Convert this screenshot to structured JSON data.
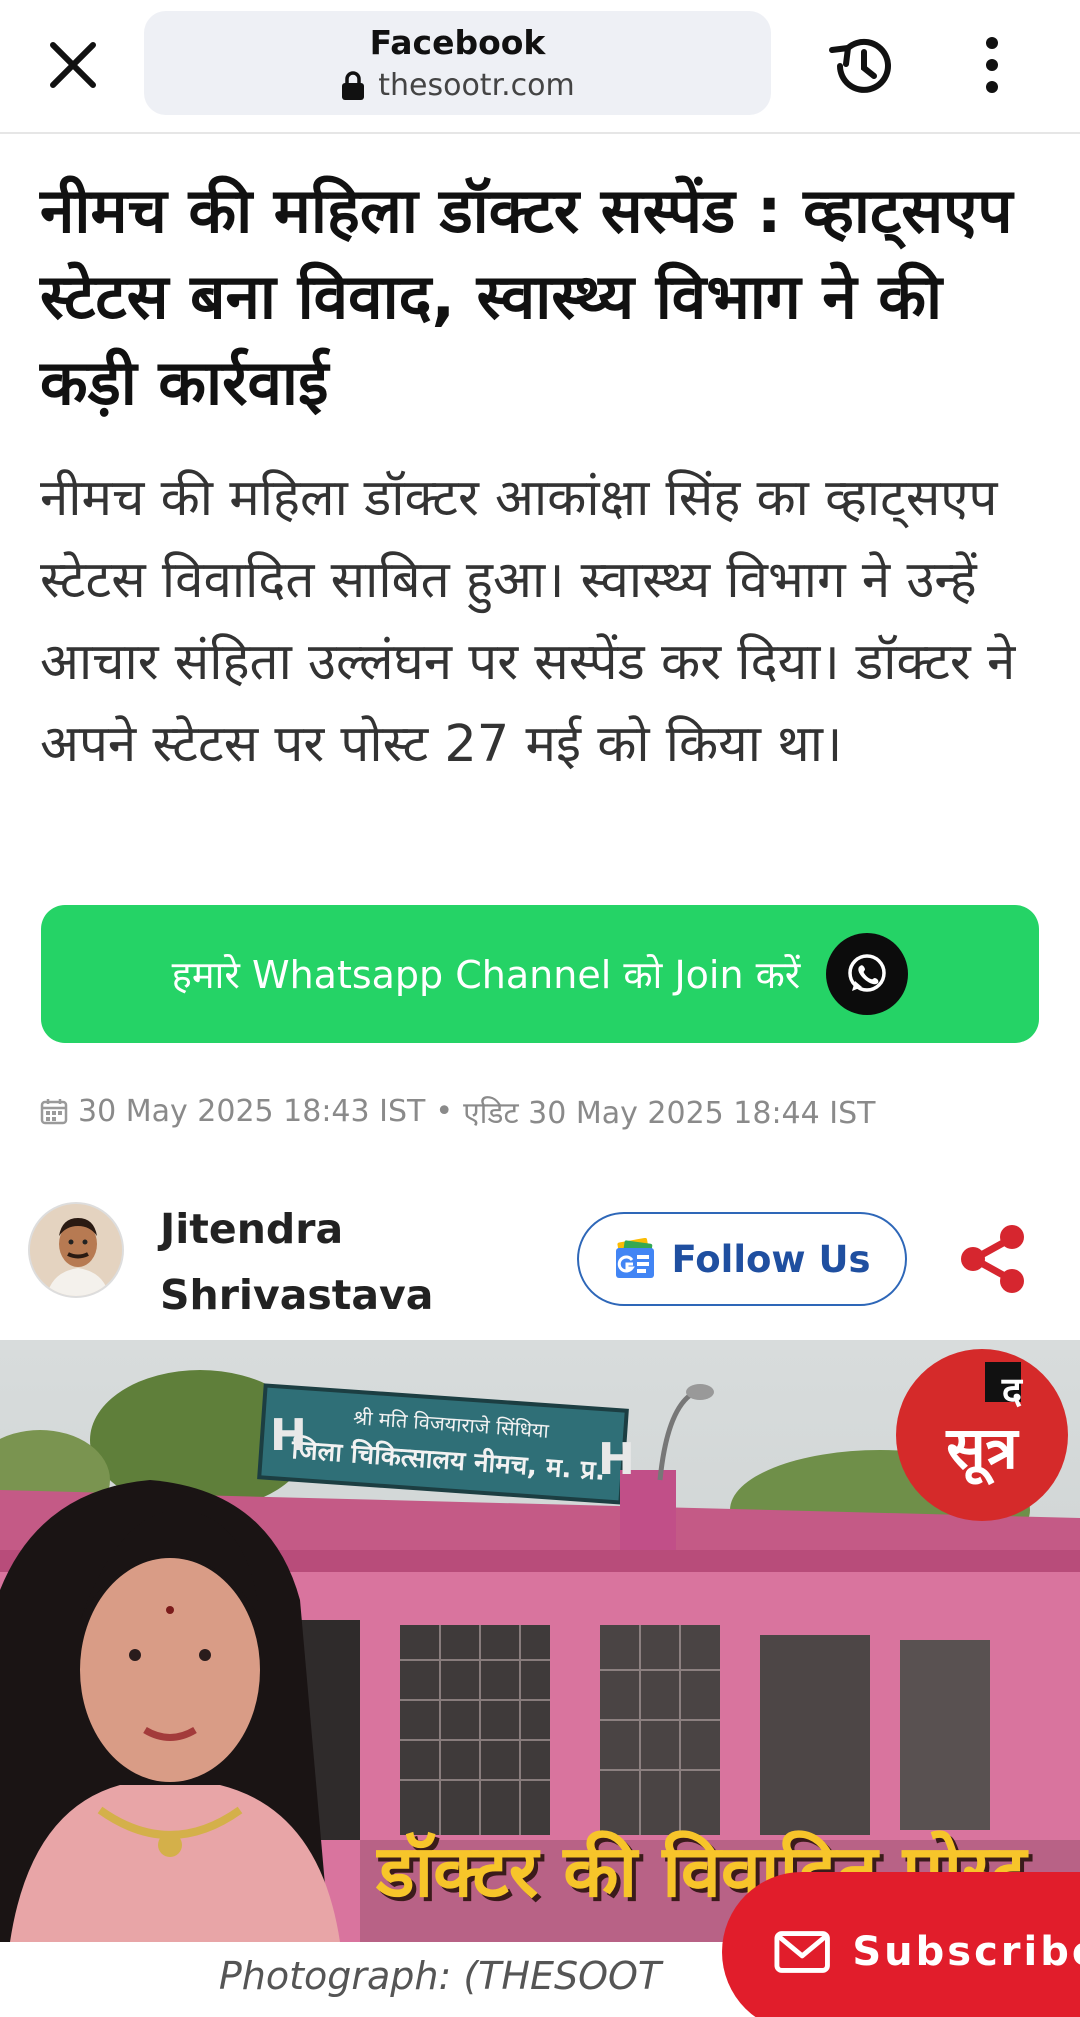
{
  "browser": {
    "page_title": "Facebook",
    "host": "thesootr.com"
  },
  "article": {
    "headline": "नीमच की महिला डॉक्टर सस्पेंड : व्हाट्सएप स्टेटस बना विवाद, स्वास्थ्य विभाग ने की कड़ी कार्रवाई",
    "summary": "नीमच की महिला डॉक्टर आकांक्षा सिंह का व्हाट्सएप स्टेटस विवादित साबित हुआ। स्वास्थ्य विभाग ने उन्हें आचार संहिता उल्लंघन पर सस्पेंड कर दिया। डॉक्टर ने अपने स्टेटस पर पोस्ट 27 मई को किया था।",
    "whatsapp_cta": "हमारे Whatsapp Channel को Join करें",
    "published": "30 May 2025 18:43 IST",
    "separator": "•",
    "edited": "एडिट 30 May 2025 18:44 IST",
    "author": {
      "first_name": "Jitendra",
      "last_name": "Shrivastava"
    },
    "follow_label": "Follow Us",
    "image_caption": "Photograph: (THESOOT"
  },
  "hero": {
    "sign_line1": "श्री मति विजयाराजे सिंधिया",
    "sign_line2": "जिला चिकित्सालय नीमच, म. प्र.",
    "sign_letter": "H",
    "overlay_text": "डॉक्टर की विवादित पोस्ट",
    "logo_top": "द",
    "logo_main": "सूत्र"
  },
  "subscribe_label": "Subscribe",
  "colors": {
    "whatsapp_green": "#25d366",
    "follow_blue": "#1f4fa0",
    "share_red": "#d6262f",
    "subscribe_red": "#e11d2b",
    "overlay_yellow": "#f7c52a"
  },
  "icons": {
    "close": "close-icon",
    "lock": "lock-icon",
    "history": "history-icon",
    "more": "more-vert-icon",
    "whatsapp": "whatsapp-icon",
    "calendar": "calendar-icon",
    "google_news": "google-news-icon",
    "share": "share-icon",
    "mail": "mail-icon"
  }
}
